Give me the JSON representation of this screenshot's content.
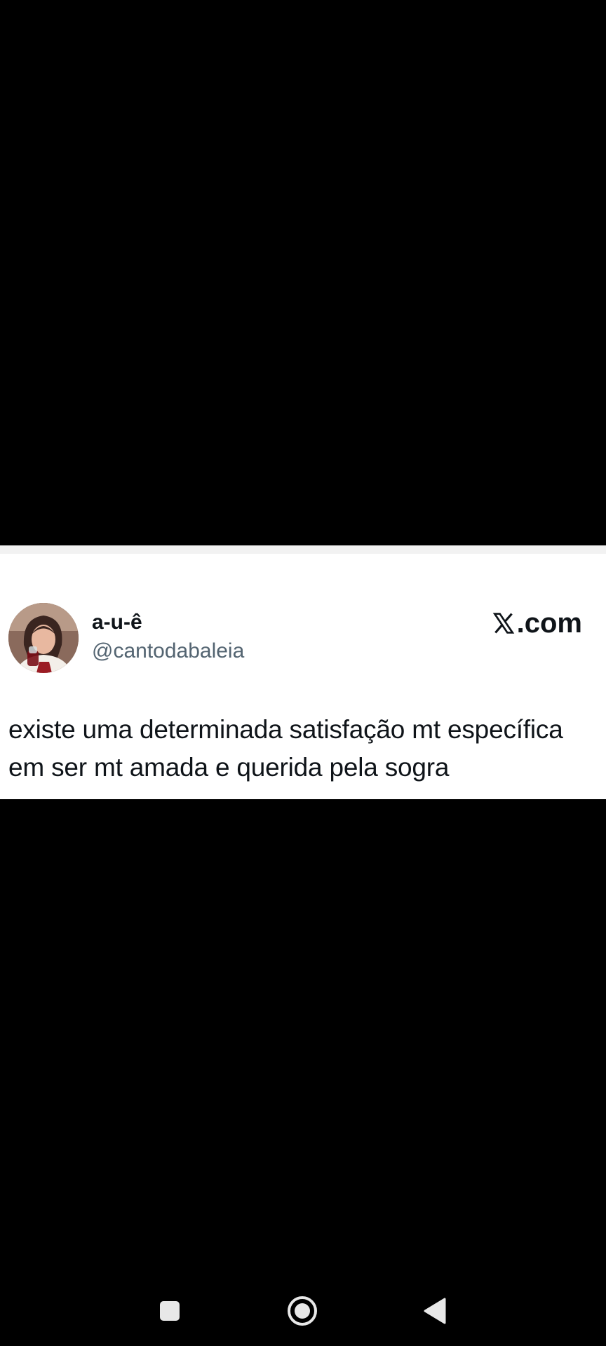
{
  "tweet": {
    "display_name": "a-u-ê",
    "handle": "@cantodabaleia",
    "brand": ".com",
    "brand_icon": "x-logo-icon",
    "text": "existe uma determinada satisfação mt específica em ser mt amada e querida pela sogra"
  },
  "nav_bar": {
    "icons": [
      "recent-apps-icon",
      "home-icon",
      "back-icon"
    ]
  },
  "colors": {
    "background": "#000000",
    "card": "#ffffff",
    "text_primary": "#0f1419",
    "text_secondary": "#536471",
    "nav_icon": "#e8e8e8"
  }
}
